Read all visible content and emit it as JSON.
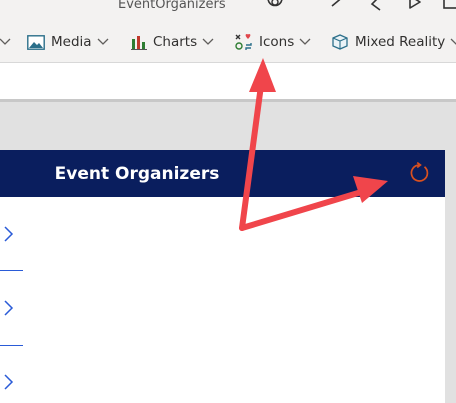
{
  "app": {
    "title": "EventOrganizers"
  },
  "ribbon": {
    "items": [
      {
        "label": "Media",
        "icon": "image-icon"
      },
      {
        "label": "Charts",
        "icon": "bar-chart-icon"
      },
      {
        "label": "Icons",
        "icon": "shapes-icon"
      },
      {
        "label": "Mixed Reality",
        "icon": "cube-icon"
      }
    ]
  },
  "screen": {
    "header_title": "Event Organizers",
    "refresh_icon": "refresh-icon",
    "header_color": "#0a1e5e",
    "accent_color": "#d9501f"
  },
  "annotations": {
    "arrow_color": "#f0454b"
  }
}
